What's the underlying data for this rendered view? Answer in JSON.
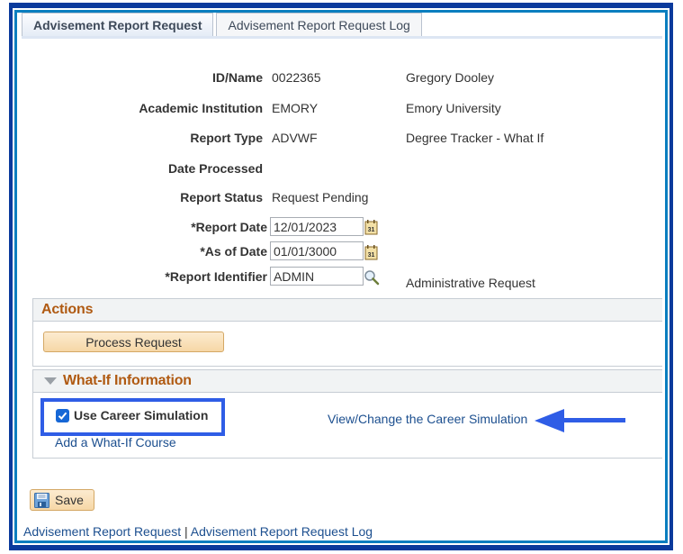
{
  "tabs": [
    {
      "label": "Advisement Report Request",
      "active": true
    },
    {
      "label": "Advisement Report Request Log",
      "active": false
    }
  ],
  "fields": {
    "id_name": {
      "label": "ID/Name",
      "value": "0022365",
      "description": "Gregory Dooley"
    },
    "institution": {
      "label": "Academic Institution",
      "value": "EMORY",
      "description": "Emory University"
    },
    "report_type": {
      "label": "Report Type",
      "value": "ADVWF",
      "description": "Degree Tracker - What If"
    },
    "date_processed": {
      "label": "Date Processed",
      "value": ""
    },
    "report_status": {
      "label": "Report Status",
      "value": "Request Pending"
    },
    "report_date": {
      "label": "*Report Date",
      "value": "12/01/2023",
      "icon": "calendar-icon"
    },
    "as_of_date": {
      "label": "*As of Date",
      "value": "01/01/3000",
      "icon": "calendar-icon"
    },
    "report_identifier": {
      "label": "*Report Identifier",
      "value": "ADMIN",
      "icon": "lookup-icon",
      "description": "Administrative Request"
    }
  },
  "actions": {
    "title": "Actions",
    "process_button": "Process Request"
  },
  "whatif": {
    "title": "What-If Information",
    "use_career_simulation": {
      "label": "Use Career Simulation",
      "checked": true
    },
    "view_change_link": "View/Change the Career Simulation",
    "add_course_link": "Add a What-If Course"
  },
  "annotation": {
    "highlight_color": "#2f5de6",
    "arrow_color": "#2f5de6"
  },
  "save_button": "Save",
  "footer": {
    "links": [
      "Advisement Report Request",
      "Advisement Report Request Log"
    ],
    "separator": " | "
  },
  "colors": {
    "outer_frame": "#0a3a9c",
    "inner_frame": "#0a7ebf",
    "section_title": "#b05a12",
    "link": "#1c4f8f",
    "button_fill": "#f6d7a6"
  }
}
